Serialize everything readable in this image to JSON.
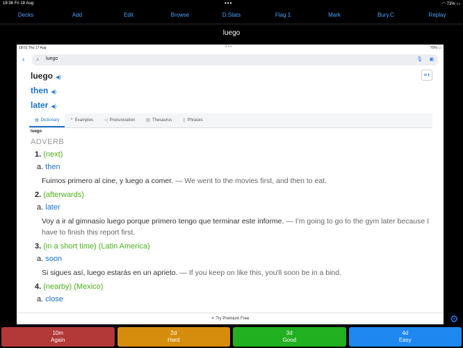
{
  "status": {
    "time_date": "18:36  Fri 18 Aug",
    "battery": "73%"
  },
  "toolbar": [
    "Decks",
    "Add",
    "Edit",
    "Browse",
    "D.Stats",
    "Flag 1",
    "Mark",
    "Bury.C",
    "Replay"
  ],
  "title": "luego",
  "webview": {
    "status": {
      "time_date": "18:01  Thu 17 Aug",
      "battery": "70%"
    },
    "search_query": "luego",
    "headwords": [
      "luego",
      "then",
      "later"
    ],
    "tabs": [
      {
        "icon": "▤",
        "label": "Dictionary"
      },
      {
        "icon": "❝",
        "label": "Examples"
      },
      {
        "icon": "◁",
        "label": "Pronunciation"
      },
      {
        "icon": "▥",
        "label": "Thesaurus"
      },
      {
        "icon": "▯",
        "label": "Phrases"
      }
    ],
    "entry_word": "luego",
    "part_of_speech": "ADVERB",
    "senses": [
      {
        "num": "1.",
        "gloss": "(next)",
        "sub": "a.",
        "translation": "then",
        "example_es": "Fuimos primero al cine, y luego a comer.",
        "example_en": " — We went to the movies first, and then to eat."
      },
      {
        "num": "2.",
        "gloss": "(afterwards)",
        "sub": "a.",
        "translation": "later",
        "example_es": "Voy a ir al gimnasio luego porque primero tengo que terminar este informe.",
        "example_en": " — I'm going to go to the gym later because I have to finish this report first."
      },
      {
        "num": "3.",
        "gloss": "(in a short time) (Latin America)",
        "sub": "a.",
        "translation": "soon",
        "example_es": "Si sigues así, luego estarás en un aprieto.",
        "example_en": " — If you keep on like this, you'll soon be in a bind."
      },
      {
        "num": "4.",
        "gloss": "(nearby) (Mexico)",
        "sub": "a.",
        "translation": "close",
        "example_es": "",
        "example_en": ""
      }
    ],
    "premium": "Try Premium Free"
  },
  "answers": [
    {
      "interval": "10m",
      "label": "Again"
    },
    {
      "interval": "2d",
      "label": "Hard"
    },
    {
      "interval": "3d",
      "label": "Good"
    },
    {
      "interval": "4d",
      "label": "Easy"
    }
  ]
}
